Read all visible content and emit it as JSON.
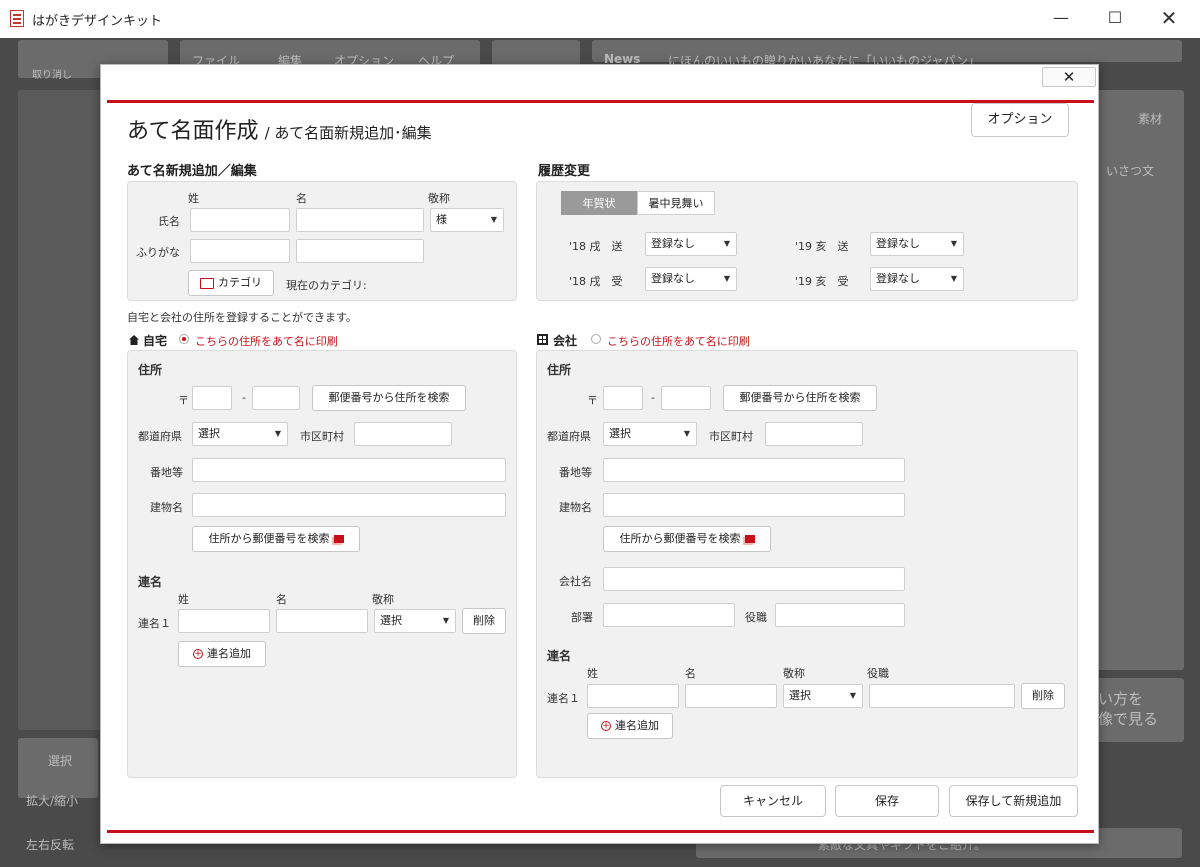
{
  "window": {
    "title": "はがきデザインキット"
  },
  "background": {
    "undo_label": "取り消し",
    "menu": [
      "ファイル",
      "編集",
      "オプション",
      "ヘルプ"
    ],
    "news_label": "News",
    "news_text": "にほんのいいもの贈りかいあなたに「いいものジャパン」",
    "material_label": "素材",
    "greeting_label": "いさつ文",
    "select_label": "選択",
    "zoom_label": "拡大/縮小",
    "flip_label": "左右反転",
    "howto_line1": "い方を",
    "howto_line2": "像で見る",
    "bottom_banner": "素敵な文具やギフトをご紹介。"
  },
  "dialog": {
    "close_symbol": "✕",
    "title": "あて名面作成",
    "subtitle": "/ あて名面新規追加･編集",
    "options_button": "オプション",
    "entry": {
      "section": "あて名新規追加／編集",
      "col_last": "姓",
      "col_first": "名",
      "col_honorific": "敬称",
      "row_name": "氏名",
      "row_kana": "ふりがな",
      "honorific_value": "様",
      "category_button": "カテゴリ",
      "current_category": "現在のカテゴリ:"
    },
    "history": {
      "section": "履歴変更",
      "tabs": [
        "年賀状",
        "暑中見舞い"
      ],
      "rows": [
        {
          "label": "'18 戌　送",
          "value": "登録なし"
        },
        {
          "label": "'19 亥　送",
          "value": "登録なし"
        },
        {
          "label": "'18 戌　受",
          "value": "登録なし"
        },
        {
          "label": "'19 亥　受",
          "value": "登録なし"
        }
      ]
    },
    "note": "自宅と会社の住所を登録することができます。",
    "home": {
      "label": "自宅",
      "print_option": "こちらの住所をあて名に印刷",
      "address_heading": "住所",
      "postal_mark": "〒",
      "postal_dash": "-",
      "zip_search": "郵便番号から住所を検索",
      "prefecture": "都道府県",
      "prefecture_value": "選択",
      "city": "市区町村",
      "street": "番地等",
      "building": "建物名",
      "addr_to_zip": "住所から郵便番号を検索",
      "joint_heading": "連名",
      "col_last": "姓",
      "col_first": "名",
      "col_honorific": "敬称",
      "joint_row": "連名１",
      "joint_honorific": "選択",
      "delete_button": "削除",
      "add_joint": "連名追加"
    },
    "company": {
      "label": "会社",
      "print_option": "こちらの住所をあて名に印刷",
      "address_heading": "住所",
      "postal_mark": "〒",
      "postal_dash": "-",
      "zip_search": "郵便番号から住所を検索",
      "prefecture": "都道府県",
      "prefecture_value": "選択",
      "city": "市区町村",
      "street": "番地等",
      "building": "建物名",
      "addr_to_zip": "住所から郵便番号を検索",
      "company_name": "会社名",
      "department": "部署",
      "position": "役職",
      "joint_heading": "連名",
      "col_last": "姓",
      "col_first": "名",
      "col_honorific": "敬称",
      "col_position": "役職",
      "joint_row": "連名１",
      "joint_honorific": "選択",
      "delete_button": "削除",
      "add_joint": "連名追加"
    },
    "footer": {
      "cancel": "キャンセル",
      "save": "保存",
      "save_new": "保存して新規追加"
    }
  }
}
